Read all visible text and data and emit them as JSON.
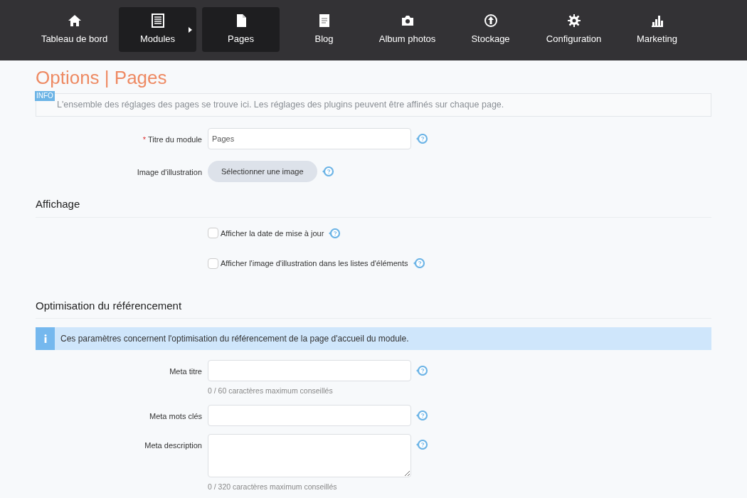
{
  "nav": [
    {
      "label": "Tableau de bord",
      "selected": false,
      "has_submenu": false
    },
    {
      "label": "Modules",
      "selected": true,
      "has_submenu": true
    },
    {
      "label": "Pages",
      "selected": true,
      "has_submenu": false
    },
    {
      "label": "Blog",
      "selected": false,
      "has_submenu": false
    },
    {
      "label": "Album photos",
      "selected": false,
      "has_submenu": false
    },
    {
      "label": "Stockage",
      "selected": false,
      "has_submenu": false
    },
    {
      "label": "Configuration",
      "selected": false,
      "has_submenu": false
    },
    {
      "label": "Marketing",
      "selected": false,
      "has_submenu": false
    }
  ],
  "page_title": "Options | Pages",
  "info": {
    "badge": "INFO",
    "text": "L'ensemble des réglages des pages se trouve ici. Les réglages des plugins peuvent être affinés sur chaque page."
  },
  "general_fields": [
    {
      "kind": "text",
      "label": "Titre du module",
      "required_mark": "*",
      "value": "Pages"
    },
    {
      "kind": "button",
      "label": "Image d'illustration",
      "button": "Sélectionner une image"
    }
  ],
  "sections": [
    {
      "title": "Affichage",
      "checkboxes": [
        {
          "label": "Afficher la date de mise à jour",
          "checked": false
        },
        {
          "label": "Afficher l'image d'illustration dans les listes d'éléments",
          "checked": false
        }
      ]
    },
    {
      "title": "Optimisation du référencement",
      "alert": "Ces paramètres concernent l'optimisation du référencement de la page d'accueil du module.",
      "fields": [
        {
          "kind": "text",
          "label": "Meta titre",
          "hint": "0 / 60 caractères maximum conseillés"
        },
        {
          "kind": "text",
          "label": "Meta mots clés"
        },
        {
          "kind": "textarea",
          "label": "Meta description",
          "hint": "0 / 320 caractères maximum conseillés"
        }
      ]
    }
  ]
}
